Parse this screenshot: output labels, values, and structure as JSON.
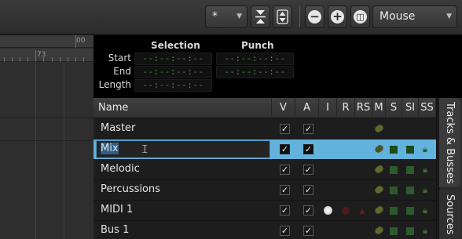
{
  "toolbar": {
    "grid_combo_value": "*",
    "mouse_mode_value": "Mouse",
    "zoom_out_symbol": "−",
    "zoom_in_symbol": "+",
    "zoom_fit_symbol": "◫"
  },
  "ruler": {
    "top_label": "00",
    "bar_label": "73"
  },
  "clocks": {
    "selection_header": "Selection",
    "punch_header": "Punch",
    "rows": [
      {
        "label": "Start",
        "selection": "--:--:--:--",
        "punch": "--:--:--:--"
      },
      {
        "label": "End",
        "selection": "--:--:--:--",
        "punch": "--:--:--:--"
      },
      {
        "label": "Length",
        "selection": "--:--:--:--",
        "punch": ""
      }
    ]
  },
  "tracklist": {
    "headers": {
      "name": "Name",
      "v": "V",
      "a": "A",
      "i": "I",
      "r": "R",
      "rs": "RS",
      "m": "M",
      "s": "S",
      "si": "SI",
      "ss": "SS"
    },
    "rows": [
      {
        "name": "Master",
        "v": "✓",
        "a": "✓"
      },
      {
        "name": "Mix",
        "v": "✓",
        "a": "✓"
      },
      {
        "name": "Melodic",
        "v": "✓",
        "a": "✓"
      },
      {
        "name": "Percussions",
        "v": "✓",
        "a": "✓"
      },
      {
        "name": "MIDI 1",
        "v": "✓",
        "a": "✓"
      },
      {
        "name": "Bus 1",
        "v": "✓",
        "a": "✓"
      }
    ]
  },
  "sidetabs": {
    "tracks_busses": "Tracks & Busses",
    "sources": "Sources"
  },
  "colors": {
    "selected_row": "#62b2dc",
    "clock_text": "#4e8a46",
    "solo_green": "#2c5a2c"
  }
}
